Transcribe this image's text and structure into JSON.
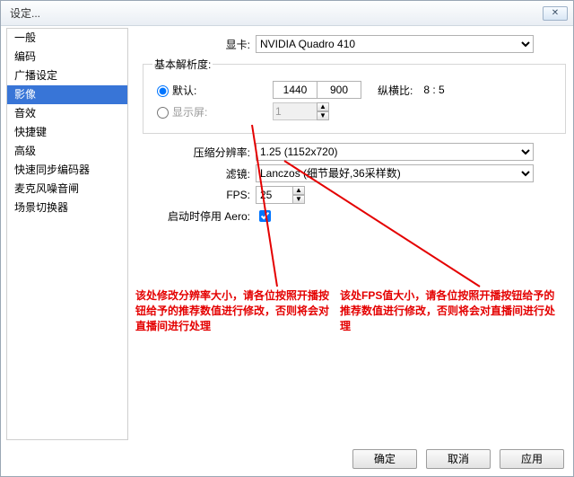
{
  "window": {
    "title": "设定...",
    "close": "✕"
  },
  "sidebar": {
    "items": [
      "一般",
      "编码",
      "广播设定",
      "影像",
      "音效",
      "快捷键",
      "高级",
      "快速同步编码器",
      "麦克风噪音闸",
      "场景切换器"
    ],
    "selected_index": 3
  },
  "videocard": {
    "label": "显卡:",
    "value": "NVIDIA Quadro 410"
  },
  "base_res": {
    "legend": "基本解析度:",
    "opt_default": "默认:",
    "default_w": "1440",
    "default_h": "900",
    "ratio_label": "纵横比:",
    "ratio_value": "8 : 5",
    "opt_monitor": "显示屏:",
    "monitor_value": "1"
  },
  "scale": {
    "label": "压缩分辨率:",
    "value": "1.25  (1152x720)"
  },
  "filter": {
    "label": "滤镜:",
    "value": "Lanczos (细节最好,36采样数)"
  },
  "fps": {
    "label": "FPS:",
    "value": "25"
  },
  "aero": {
    "label": "启动时停用 Aero:"
  },
  "annot": {
    "left": "该处修改分辨率大小，请各位按照开播按钮给予的推荐数值进行修改，否则将会对直播间进行处理",
    "right": "该处FPS值大小，请各位按照开播按钮给予的推荐数值进行修改，否则将会对直播间进行处理"
  },
  "buttons": {
    "ok": "确定",
    "cancel": "取消",
    "apply": "应用"
  }
}
